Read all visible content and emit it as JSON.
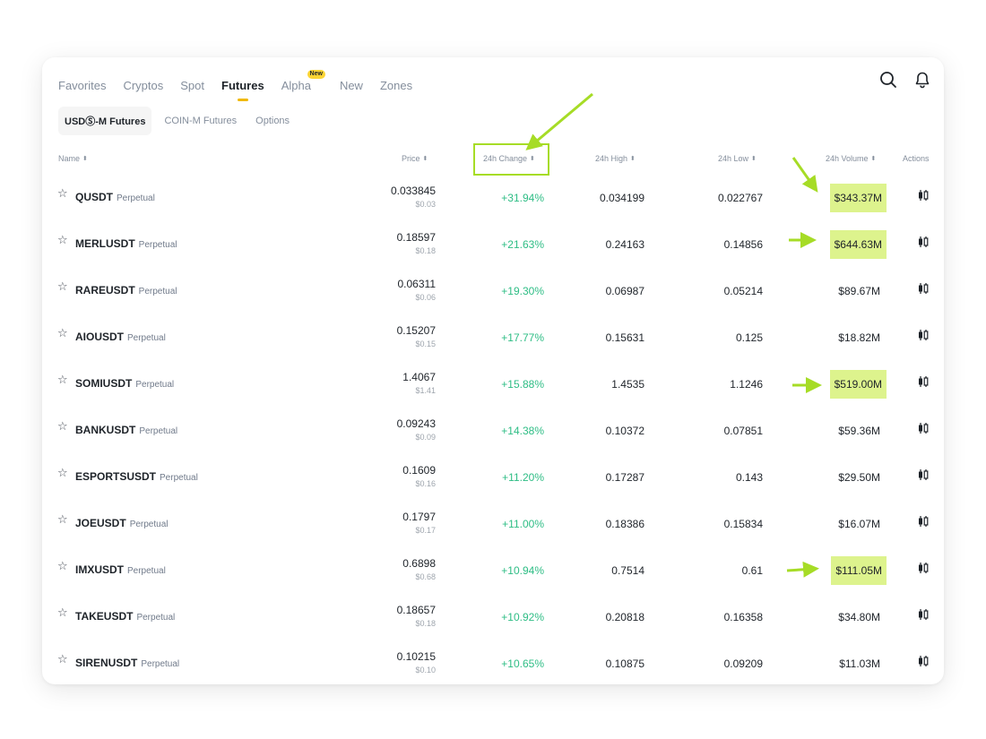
{
  "nav": {
    "tabs": [
      "Favorites",
      "Cryptos",
      "Spot",
      "Futures",
      "Alpha",
      "New",
      "Zones"
    ],
    "active_tab": "Futures",
    "alpha_badge": "New"
  },
  "icons": {
    "search": "search-icon",
    "bell": "bell-icon",
    "action": "candlestick-chart-icon",
    "star": "star-icon"
  },
  "subtabs": [
    "USDⓈ-M Futures",
    "COIN-M Futures",
    "Options"
  ],
  "active_subtab": "USDⓈ-M Futures",
  "columns": {
    "name": "Name",
    "price": "Price",
    "change": "24h Change",
    "high": "24h High",
    "low": "24h Low",
    "volume": "24h Volume",
    "actions": "Actions"
  },
  "colors": {
    "accent": "#f0b90b",
    "positive": "#2ebd85",
    "annotation": "#a6dc26",
    "highlight": "#ddf38d"
  },
  "rows": [
    {
      "symbol": "QUSDT",
      "type": "Perpetual",
      "price": "0.033845",
      "price_usd": "$0.03",
      "change": "+31.94%",
      "high": "0.034199",
      "low": "0.022767",
      "volume": "$343.37M",
      "highlight": true
    },
    {
      "symbol": "MERLUSDT",
      "type": "Perpetual",
      "price": "0.18597",
      "price_usd": "$0.18",
      "change": "+21.63%",
      "high": "0.24163",
      "low": "0.14856",
      "volume": "$644.63M",
      "highlight": true
    },
    {
      "symbol": "RAREUSDT",
      "type": "Perpetual",
      "price": "0.06311",
      "price_usd": "$0.06",
      "change": "+19.30%",
      "high": "0.06987",
      "low": "0.05214",
      "volume": "$89.67M",
      "highlight": false
    },
    {
      "symbol": "AIOUSDT",
      "type": "Perpetual",
      "price": "0.15207",
      "price_usd": "$0.15",
      "change": "+17.77%",
      "high": "0.15631",
      "low": "0.125",
      "volume": "$18.82M",
      "highlight": false
    },
    {
      "symbol": "SOMIUSDT",
      "type": "Perpetual",
      "price": "1.4067",
      "price_usd": "$1.41",
      "change": "+15.88%",
      "high": "1.4535",
      "low": "1.1246",
      "volume": "$519.00M",
      "highlight": true
    },
    {
      "symbol": "BANKUSDT",
      "type": "Perpetual",
      "price": "0.09243",
      "price_usd": "$0.09",
      "change": "+14.38%",
      "high": "0.10372",
      "low": "0.07851",
      "volume": "$59.36M",
      "highlight": false
    },
    {
      "symbol": "ESPORTSUSDT",
      "type": "Perpetual",
      "price": "0.1609",
      "price_usd": "$0.16",
      "change": "+11.20%",
      "high": "0.17287",
      "low": "0.143",
      "volume": "$29.50M",
      "highlight": false
    },
    {
      "symbol": "JOEUSDT",
      "type": "Perpetual",
      "price": "0.1797",
      "price_usd": "$0.17",
      "change": "+11.00%",
      "high": "0.18386",
      "low": "0.15834",
      "volume": "$16.07M",
      "highlight": false
    },
    {
      "symbol": "IMXUSDT",
      "type": "Perpetual",
      "price": "0.6898",
      "price_usd": "$0.68",
      "change": "+10.94%",
      "high": "0.7514",
      "low": "0.61",
      "volume": "$111.05M",
      "highlight": true
    },
    {
      "symbol": "TAKEUSDT",
      "type": "Perpetual",
      "price": "0.18657",
      "price_usd": "$0.18",
      "change": "+10.92%",
      "high": "0.20818",
      "low": "0.16358",
      "volume": "$34.80M",
      "highlight": false
    },
    {
      "symbol": "SIRENUSDT",
      "type": "Perpetual",
      "price": "0.10215",
      "price_usd": "$0.10",
      "change": "+10.65%",
      "high": "0.10875",
      "low": "0.09209",
      "volume": "$11.03M",
      "highlight": false
    }
  ]
}
